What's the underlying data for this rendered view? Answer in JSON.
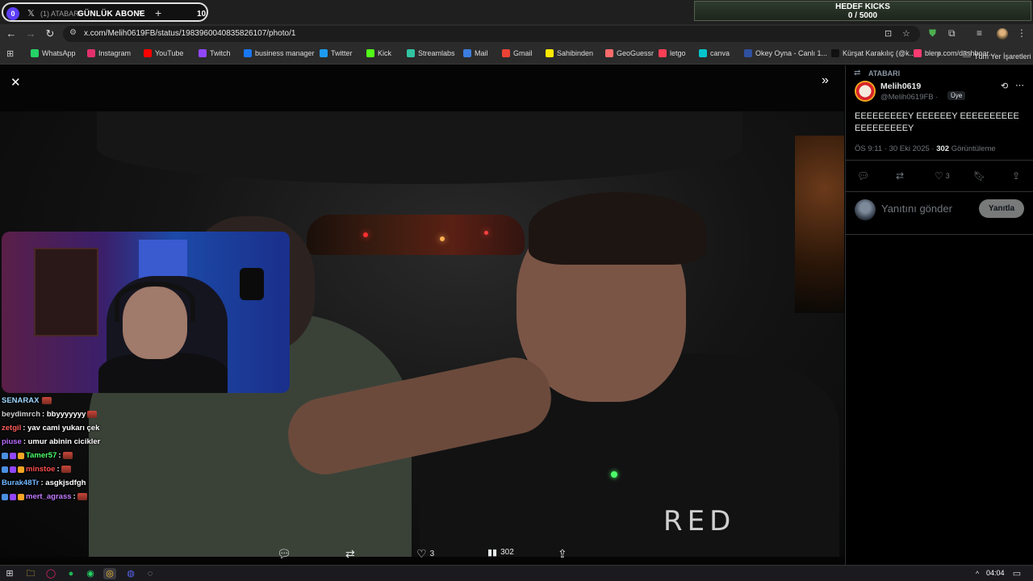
{
  "tabstrip": {
    "tab_number": "0",
    "tab_title": "(1) ATABARI",
    "new_tab": "+",
    "overlay_label": "GÜNLÜK ABONE",
    "overlay_count": "10",
    "kicks_title": "HEDEF KICKS",
    "kicks_value": "0 / 5000"
  },
  "toolbar": {
    "url": "x.com/Melih0619FB/status/1983960040835826107/photo/1"
  },
  "bookmarks": [
    {
      "label": "WhatsApp",
      "color": "#25d366"
    },
    {
      "label": "Instagram",
      "color": "#e1306c"
    },
    {
      "label": "YouTube",
      "color": "#ff0000"
    },
    {
      "label": "Twitch",
      "color": "#9146ff"
    },
    {
      "label": "business manager",
      "color": "#1877f2"
    },
    {
      "label": "Twitter",
      "color": "#1d9bf0"
    },
    {
      "label": "Kick",
      "color": "#53fc18"
    },
    {
      "label": "Streamlabs",
      "color": "#31c3a2"
    },
    {
      "label": "Mail",
      "color": "#3b7de0"
    },
    {
      "label": "Gmail",
      "color": "#ea4335"
    },
    {
      "label": "Sahibinden",
      "color": "#ffe800"
    },
    {
      "label": "GeoGuessr",
      "color": "#ff6b6b"
    },
    {
      "label": "letgo",
      "color": "#ff3f55"
    },
    {
      "label": "canva",
      "color": "#00c4cc"
    },
    {
      "label": "Okey Oyna - Canlı 1...",
      "color": "#3050a0"
    },
    {
      "label": "Kürşat Karakılıç (@k...",
      "color": "#111111"
    },
    {
      "label": "blerp.com/dashboar...",
      "color": "#ff3b6f"
    }
  ],
  "bookmarks_all": "Tüm Yer İşaretleri",
  "photo": {
    "shirt_text": "RED"
  },
  "chat": [
    {
      "user": "SENARAX",
      "color": "#9fd8ff",
      "message": "",
      "emote": true
    },
    {
      "user": "beydimrch",
      "color": "#d0d0d0",
      "message": ": bbyyyyyyy",
      "emote": true
    },
    {
      "user": "zetgil",
      "color": "#ff5c5c",
      "message": ": yav cami yukarı çek",
      "emote": false
    },
    {
      "user": "piuse",
      "color": "#b86bff",
      "message": ": umur abinin cicikler",
      "emote": false
    },
    {
      "user": "Tamer57",
      "color": "#4cff6a",
      "message": ":",
      "emote": true
    },
    {
      "user": "minstoe",
      "color": "#ff4d4d",
      "message": ":",
      "emote": true
    },
    {
      "user": "Burak48Tr",
      "color": "#6fb6ff",
      "message": ": asgkjsdfgh",
      "emote": false
    },
    {
      "user": "mert_agrass",
      "color": "#c27cff",
      "message": ":",
      "emote": true
    }
  ],
  "viewer_actions": {
    "likes": "3",
    "views": "302"
  },
  "tweet": {
    "repost_label": "ATABARI",
    "author_name": "Melih0619",
    "author_handle": "@Melih0619FB ·",
    "author_badge": "Üye",
    "text": "EEEEEEEEEY EEEEEEY EEEEEEEEEEEEEEEEEEEY",
    "time": "ÖS 9:11 · 30 Eki 2025 ·",
    "views_count": "302",
    "views_label": "Görüntüleme",
    "likes": "3",
    "reply_placeholder": "Yanıtını gönder",
    "reply_button": "Yanıtla"
  },
  "taskbar": {
    "time": "04:04"
  }
}
